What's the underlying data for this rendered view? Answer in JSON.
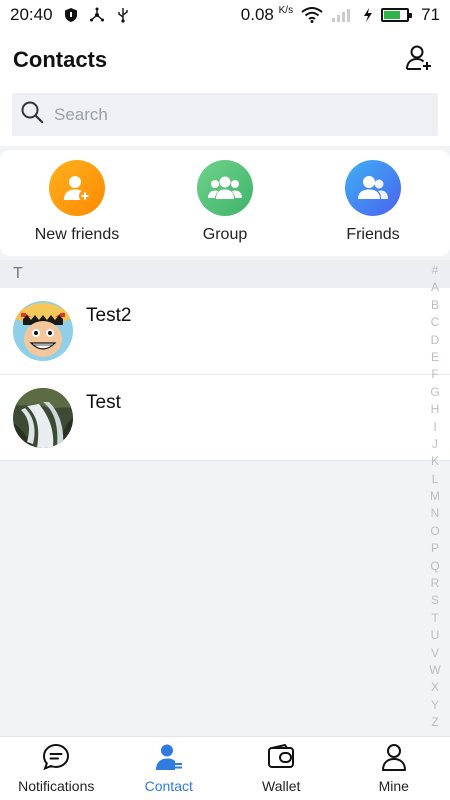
{
  "status_bar": {
    "time": "20:40",
    "speed_value": "0.08",
    "speed_unit": "K/s",
    "battery": "71",
    "battery_level": 0.71,
    "battery_color": "#2fb34a"
  },
  "header": {
    "title": "Contacts",
    "add_icon": "add-contact-icon"
  },
  "search": {
    "placeholder": "Search",
    "value": ""
  },
  "quick_actions": [
    {
      "label": "New friends",
      "icon": "add-friend-icon",
      "color_from": "#ffb01e",
      "color_to": "#ff8a00"
    },
    {
      "label": "Group",
      "icon": "group-icon",
      "color_from": "#6fd28a",
      "color_to": "#3fb36a"
    },
    {
      "label": "Friends",
      "icon": "friends-icon",
      "color_from": "#3fb0f5",
      "color_to": "#4a63ef"
    }
  ],
  "contacts": {
    "section_letter": "T",
    "items": [
      {
        "name": "Test2",
        "avatar": "cartoon-pirate-avatar"
      },
      {
        "name": "Test",
        "avatar": "waterfall-photo-avatar"
      }
    ]
  },
  "alphabet_index": [
    "#",
    "A",
    "B",
    "C",
    "D",
    "E",
    "F",
    "G",
    "H",
    "I",
    "J",
    "K",
    "L",
    "M",
    "N",
    "O",
    "P",
    "Q",
    "R",
    "S",
    "T",
    "U",
    "V",
    "W",
    "X",
    "Y",
    "Z"
  ],
  "tabs": [
    {
      "label": "Notifications",
      "icon": "chat-bubble-icon",
      "active": false
    },
    {
      "label": "Contact",
      "icon": "contact-icon",
      "active": true
    },
    {
      "label": "Wallet",
      "icon": "wallet-icon",
      "active": false
    },
    {
      "label": "Mine",
      "icon": "person-icon",
      "active": false
    }
  ],
  "colors": {
    "accent": "#2f7be0",
    "background": "#f2f3f5"
  }
}
